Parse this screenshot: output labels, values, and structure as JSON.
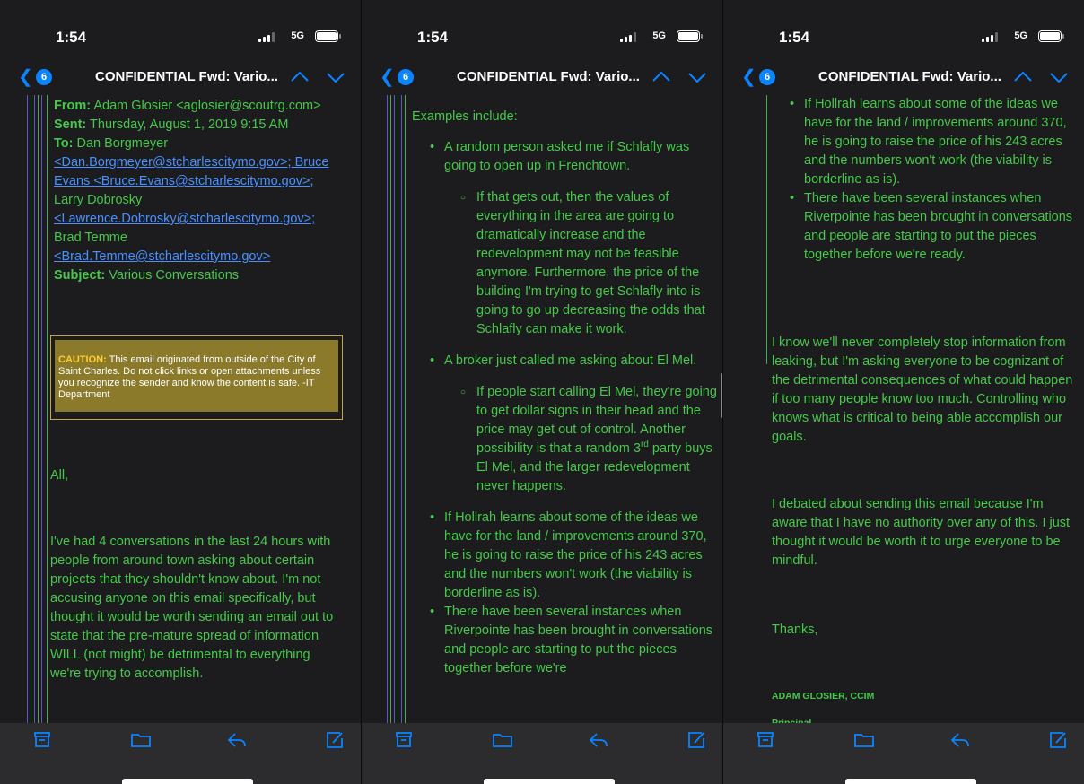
{
  "status": {
    "time": "1:54",
    "network": "5G"
  },
  "nav": {
    "unread_count": "6",
    "subject": "CONFIDENTIAL Fwd: Vario..."
  },
  "email": {
    "from_label": "From:",
    "from_value": "Adam Glosier <aglosier@scoutrg.com>",
    "sent_label": "Sent:",
    "sent_value": "Thursday, August 1, 2019 9:15 AM",
    "to_label": "To:",
    "to_1": "Dan Borgmeyer",
    "to_1_email": "<Dan.Borgmeyer@stcharlescitymo.gov>; Bruce",
    "to_2": "Evans <Bruce.Evans@stcharlescitymo.gov>;",
    "to_3": "Larry Dobrosky",
    "to_3_email": "<Lawrence.Dobrosky@stcharlescitymo.gov>;",
    "to_4": "Brad Temme",
    "to_4_email": "<Brad.Temme@stcharlescitymo.gov>",
    "subject_label": "Subject:",
    "subject_value": "Various Conversations",
    "caution_label": "CAUTION:",
    "caution_text": "This email originated from outside of the City of Saint Charles. Do not click links or open attachments unless you recognize the sender and know the content is safe. -IT Department",
    "greeting": "All,",
    "para1": "I've had 4 conversations in the last 24 hours with people from around town asking about certain projects that they shouldn't know about.  I'm not accusing anyone on this email specifically, but thought it would be worth sending an email out to state that the pre-mature spread of information WILL (not might) be detrimental to everything we're trying to accomplish.",
    "examples_intro": "Examples include:",
    "bullet1": "A random person asked me if Schlafly was going to open up in Frenchtown.",
    "bullet1_sub": "If that gets out, then the values of everything in the area are going to dramatically increase and the redevelopment may not be feasible anymore.  Furthermore, the price of the building I'm trying to get Schlafly into is going to go up decreasing the odds that Schlafly can make it work.",
    "bullet2": "A broker just called me asking about El Mel.",
    "bullet2_sub_a": "If people start calling El Mel, they're going to get dollar signs in their head and the price may get out of control. Another possibility is that a random 3",
    "bullet2_sub_sup": "rd",
    "bullet2_sub_b": " party buys El Mel, and the larger redevelopment never happens.",
    "bullet3": "If Hollrah learns about some of the ideas we have for the land / improvements around 370, he is going to raise the price of his 243 acres and the numbers won't work (the viability is borderline as is).",
    "bullet4": "There have been several instances when Riverpointe has been brought in conversations and people are starting to put the pieces together before we're",
    "bullet4_full": "There have been several instances when Riverpointe has been brought in conversations and people are starting to put the pieces together before we're ready.",
    "para2": "I know we'll never completely stop information from leaking, but I'm asking everyone to be cognizant of the detrimental consequences of what could happen if too many people know too much.  Controlling who knows what is critical to being able accomplish our goals.",
    "para3": "I debated about sending this email because I'm aware that I have no authority over any of this.  I just thought it would be worth it to urge everyone to be mindful.",
    "thanks": "Thanks,",
    "sig_name": "ADAM GLOSIER, CCIM",
    "sig_title": "Principal"
  },
  "icons": [
    "archive-icon",
    "folder-icon",
    "reply-icon",
    "compose-icon",
    "chevron-left-icon",
    "chevron-up-icon",
    "chevron-down-icon"
  ],
  "colors": {
    "text_green": "#46c84a",
    "link_blue": "#4a90ff",
    "accent": "#0a84ff",
    "caution_bg": "#8a7a2a"
  }
}
